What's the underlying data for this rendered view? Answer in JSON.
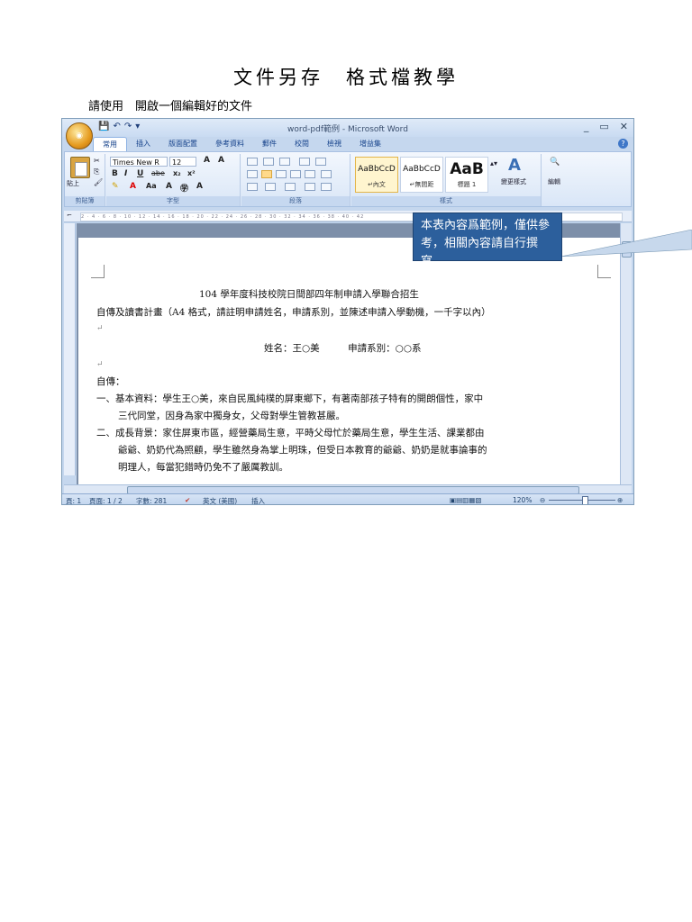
{
  "heading": {
    "title": "文件另存　格式檔教學",
    "instruction": "請使用　開啟一個編輯好的文件"
  },
  "window": {
    "title": "word-pdf範例 - Microsoft Word",
    "qat": [
      "💾",
      "↶",
      "↷",
      "▾"
    ],
    "controls": [
      "_",
      "▭",
      "✕"
    ],
    "tabs": [
      "常用",
      "插入",
      "版面配置",
      "參考資料",
      "郵件",
      "校閱",
      "檢視",
      "增益集"
    ]
  },
  "ribbon": {
    "clipboard": {
      "paste": "貼上",
      "label": "剪貼簿"
    },
    "font": {
      "name": "Times New R",
      "size": "12",
      "label": "字型",
      "buttons": [
        "B",
        "I",
        "U",
        "abe",
        "x₂",
        "x²",
        "A",
        "Aa",
        "A",
        "A"
      ]
    },
    "paragraph": {
      "label": "段落"
    },
    "styles": {
      "label": "樣式",
      "items": [
        {
          "sample": "AaBbCcD",
          "name": "↵內文"
        },
        {
          "sample": "AaBbCcD",
          "name": "↵無間距"
        },
        {
          "sample": "AaB",
          "name": "標題 1"
        }
      ],
      "change": "變更樣式"
    },
    "editing": {
      "label": "編輯"
    }
  },
  "ruler": "2 · 4 · 6 · 8 · 10 · 12 · 14 · 16 · 18 · 20 · 22 · 24 · 26 · 28 · 30 · 32 · 34 · 36 · 38 · 40 · 42",
  "document": {
    "line1": "104 學年度科技校院日間部四年制申請入學聯合招生",
    "line2": "自傳及讀書計畫（A4 格式，請註明申請姓名，申請系別，並陳述申請入學動機，一千字以內）",
    "line3": "姓名：王○美　　　申請系別：○○系",
    "line4": "自傳：",
    "line5": "一、基本資料：學生王○美，來自民風純樸的屏東鄉下，有著南部孩子特有的開朗個性，家中",
    "line6": "三代同堂，因身為家中獨身女，父母對學生管教甚嚴。",
    "line7": "二、成長背景：家住屏東市區，經營藥局生意，平時父母忙於藥局生意，學生生活、課業都由",
    "line8": "爺爺、奶奶代為照顧，學生雖然身為掌上明珠，但受日本教育的爺爺、奶奶是就事論事的",
    "line9": "明理人，每當犯錯時仍免不了嚴厲教訓。",
    "pilcrow": "↵"
  },
  "callout": "本表內容爲範例，僅供參考，相關內容請自行撰寫。",
  "status": {
    "page": "頁: 1",
    "pages": "頁面: 1 / 2",
    "words": "字數: 281",
    "lang": "英文 (美國)",
    "mode": "插入",
    "zoom": "120%"
  }
}
